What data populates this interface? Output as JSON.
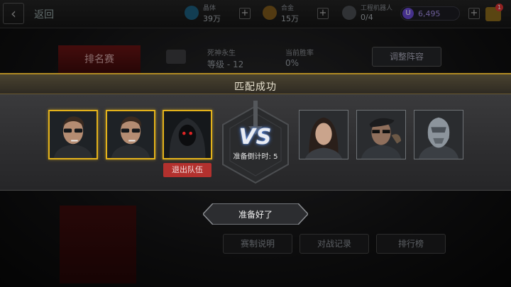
{
  "topbar": {
    "back_label": "返回",
    "resources": [
      {
        "name": "晶体",
        "value": "39万",
        "icon": "crystal-icon",
        "color": "#3aa8d8"
      },
      {
        "name": "合金",
        "value": "15万",
        "icon": "alloy-icon",
        "color": "#d8a23a"
      },
      {
        "name": "工程机器人",
        "value": "0/4",
        "icon": "robot-icon",
        "color": "#9aa0a6"
      }
    ],
    "credit": {
      "value": "6,495",
      "symbol": "U"
    },
    "cart_badge": "1"
  },
  "lobby": {
    "rank_tab": "排名赛",
    "rank_title": "死神永生",
    "rank_level": "等级 - 12",
    "winrate_title": "当前胜率",
    "winrate": "0%",
    "adjust_lineup": "调整阵容",
    "bottom_buttons": [
      "赛制说明",
      "对战记录",
      "排行榜"
    ]
  },
  "match": {
    "title": "匹配成功",
    "vs": "VS",
    "countdown": "准备倒计时: 5",
    "leave_team": "退出队伍",
    "ready": "准备好了",
    "accent_color": "#e3b21b",
    "my_team": [
      {
        "avatar": "pilot-sunglasses-avatar"
      },
      {
        "avatar": "pilot-sunglasses-avatar"
      },
      {
        "avatar": "hooded-red-eyes-avatar"
      }
    ],
    "enemy_team": [
      {
        "avatar": "woman-pilot-avatar"
      },
      {
        "avatar": "beret-soldier-avatar"
      },
      {
        "avatar": "cyborg-avatar"
      }
    ]
  }
}
